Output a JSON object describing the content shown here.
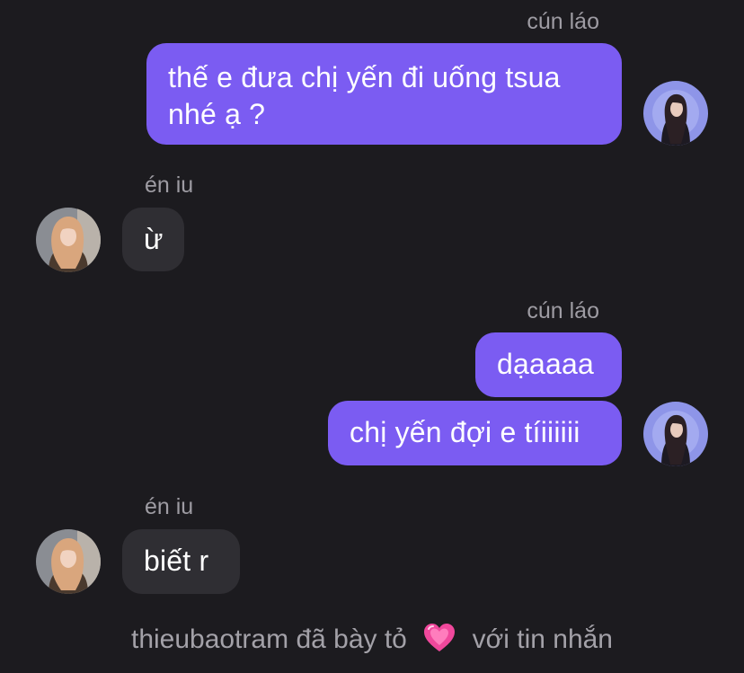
{
  "colors": {
    "background": "#1c1b1f",
    "outgoing_bubble": "#7b5cf2",
    "incoming_bubble": "#2f2e33",
    "secondary_text": "#9e9ca3"
  },
  "messages": [
    {
      "sender": "cún láo",
      "text": "thế e đưa chị yến đi uống tsua\nnhé ạ ?"
    },
    {
      "sender": "én iu",
      "text": "ừ"
    },
    {
      "sender": "cún láo",
      "text": "dạaaaa"
    },
    {
      "text": "chị yến đợi e tíiiiiii"
    },
    {
      "sender": "én iu",
      "text": "biết r"
    }
  ],
  "reaction": {
    "user": "thieubaotram",
    "action": "đã bày tỏ",
    "icon": "sparkling-heart-icon",
    "suffix": "với tin nhắn"
  }
}
